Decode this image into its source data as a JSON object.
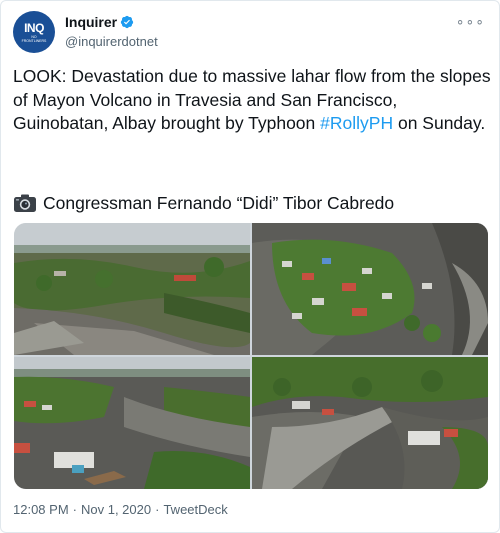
{
  "account": {
    "display_name": "Inquirer",
    "handle": "@inquirerdotnet",
    "avatar_text": "INQ",
    "avatar_subtext": "NO FRONTLINERS",
    "verified": true,
    "more_label": "∘∘∘"
  },
  "tweet": {
    "text_before": "LOOK: Devastation due to massive lahar flow from the slopes of Mayon Volcano in Travesia and San Francisco, Guinobatan, Albay brought by Typhoon ",
    "hashtag": "#RollyPH",
    "text_after": " on Sunday.",
    "credit": "Congressman Fernando “Didi” Tibor Cabredo"
  },
  "media": {
    "photos": [
      {
        "icon": "aerial-lahar-photo-1"
      },
      {
        "icon": "aerial-lahar-photo-2"
      },
      {
        "icon": "aerial-lahar-photo-3"
      },
      {
        "icon": "aerial-lahar-photo-4"
      }
    ]
  },
  "footer": {
    "time": "12:08 PM",
    "separator": "·",
    "date": "Nov 1, 2020",
    "source": "TweetDeck"
  },
  "colors": {
    "accent": "#1d9bf0",
    "avatar_bg": "#1a4f96",
    "secondary_text": "#536471"
  }
}
